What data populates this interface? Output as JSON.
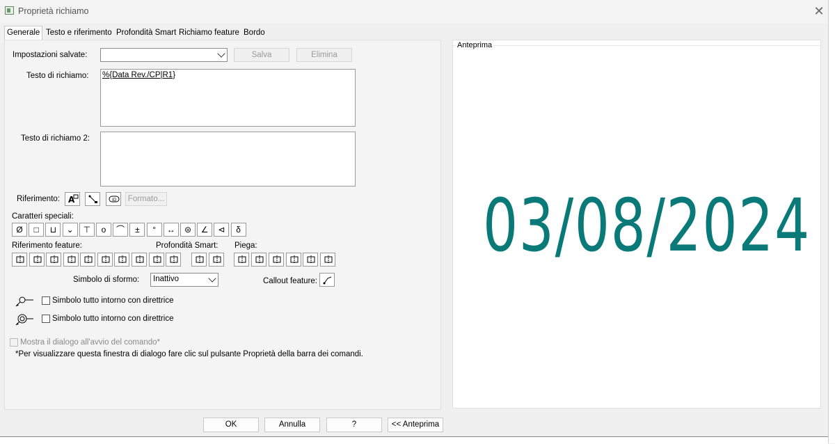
{
  "window": {
    "title": "Proprietà richiamo"
  },
  "tabs": [
    {
      "label": "Generale",
      "active": true
    },
    {
      "label": "Testo e riferimento"
    },
    {
      "label": "Profondità Smart"
    },
    {
      "label": "Richiamo feature"
    },
    {
      "label": "Bordo"
    }
  ],
  "general": {
    "saved_settings_label": "Impostazioni salvate:",
    "saved_settings_value": "",
    "save_label": "Salva",
    "delete_label": "Elimina",
    "callout_text_label": "Testo di richiamo:",
    "callout_text_value": "%{Data Rev./CP|R1}",
    "callout_text2_label": "Testo di richiamo 2:",
    "callout_text2_value": "",
    "reference_label": "Riferimento:",
    "format_label": "Formato...",
    "special_chars_label": "Caratteri speciali:",
    "special_chars": [
      "Ø",
      "□",
      "⊔",
      "⌄",
      "⊤",
      "o",
      "⌒",
      "±",
      "°",
      "↔",
      "⊜",
      "∠",
      "⊲",
      "δ"
    ],
    "feature_ref_label": "Riferimento feature:",
    "smart_depth_label": "Profondità Smart:",
    "bend_label": "Piega:",
    "draft_symbol_label": "Simbolo di sformo:",
    "draft_symbol_value": "Inattivo",
    "callout_feature_label": "Callout feature:",
    "all_around_1_label": "Simbolo tutto intorno con direttrice",
    "all_around_2_label": "Simbolo tutto intorno con direttrice",
    "show_dialog_label": "Mostra il dialogo all'avvio del comando*",
    "note_text": "*Per visualizzare questa finestra di dialogo fare clic sul pulsante Proprietà della barra dei comandi."
  },
  "preview": {
    "title": "Anteprima",
    "text": "03/08/2024",
    "text_color": "#0a7a78"
  },
  "footer": {
    "ok_label": "OK",
    "cancel_label": "Annulla",
    "help_label": "?",
    "preview_toggle_label": "<< Anteprima"
  }
}
